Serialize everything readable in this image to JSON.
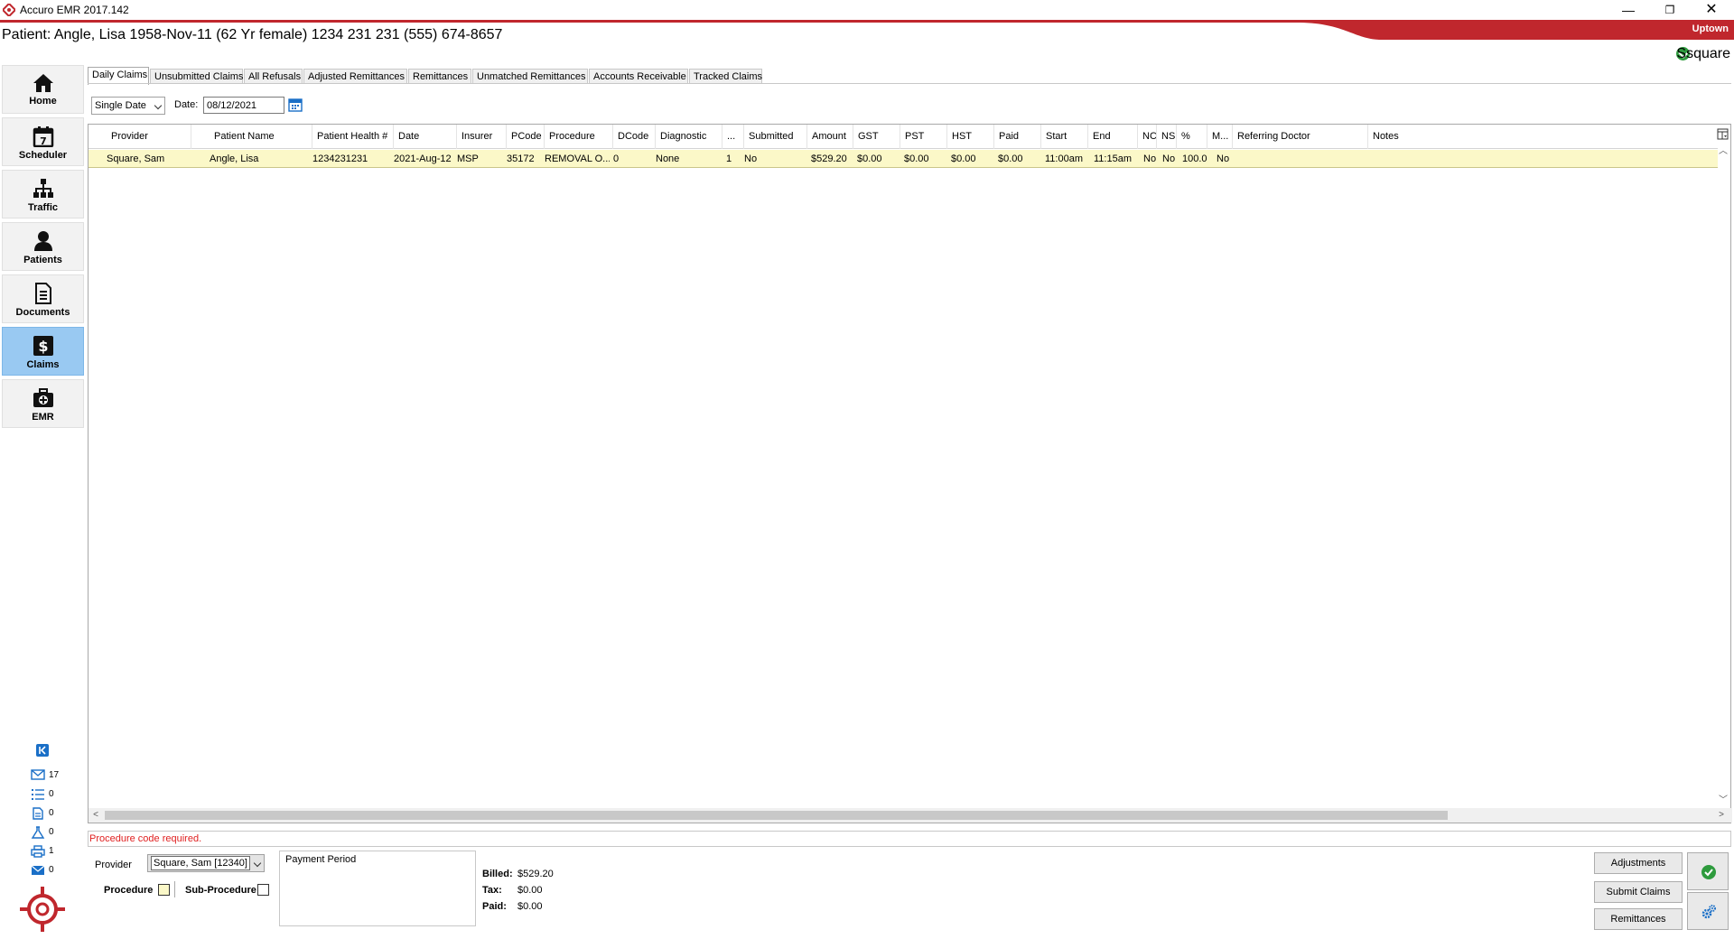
{
  "window": {
    "title": "Accuro EMR 2017.142",
    "minimize_glyph": "—",
    "restore_glyph": "❐",
    "close_glyph": "✕",
    "location": "Uptown",
    "accent_color": "#c0272d"
  },
  "header": {
    "patient": "Patient: Angle, Lisa 1958-Nov-11 (62 Yr female) 1234 231 231 (555) 674-8657",
    "user": "Ssquare"
  },
  "sidebar": {
    "items": [
      {
        "label": "Home",
        "icon": "home-icon"
      },
      {
        "label": "Scheduler",
        "icon": "calendar-icon"
      },
      {
        "label": "Traffic",
        "icon": "org-chart-icon"
      },
      {
        "label": "Patients",
        "icon": "person-icon"
      },
      {
        "label": "Documents",
        "icon": "document-icon"
      },
      {
        "label": "Claims",
        "icon": "dollar-icon",
        "active": true
      },
      {
        "label": "EMR",
        "icon": "medical-bag-icon"
      }
    ],
    "counters": [
      {
        "icon": "mail-icon",
        "value": "17"
      },
      {
        "icon": "task-list-icon",
        "value": "0"
      },
      {
        "icon": "document-icon",
        "value": "0"
      },
      {
        "icon": "lab-flask-icon",
        "value": "0"
      },
      {
        "icon": "printer-icon",
        "value": "1"
      },
      {
        "icon": "message-icon",
        "value": "0"
      }
    ]
  },
  "tabs": [
    {
      "label": "Daily Claims",
      "active": true
    },
    {
      "label": "Unsubmitted Claims"
    },
    {
      "label": "All Refusals"
    },
    {
      "label": "Adjusted Remittances"
    },
    {
      "label": "Remittances"
    },
    {
      "label": "Unmatched Remittances"
    },
    {
      "label": "Accounts Receivable"
    },
    {
      "label": "Tracked Claims"
    }
  ],
  "filter": {
    "mode": "Single Date",
    "date_label": "Date:",
    "date_value": "08/12/2021"
  },
  "grid": {
    "columns": [
      "Provider",
      "Patient Name",
      "Patient Health #",
      "Date",
      "Insurer",
      "PCode",
      "Procedure",
      "DCode",
      "Diagnostic",
      "...",
      "Submitted",
      "Amount",
      "GST",
      "PST",
      "HST",
      "Paid",
      "Start",
      "End",
      "NC",
      "NS",
      "%",
      "M...",
      "Referring Doctor",
      "Notes"
    ],
    "rows": [
      [
        "Square, Sam",
        "Angle, Lisa",
        "1234231231",
        "2021-Aug-12",
        "MSP",
        "35172",
        "REMOVAL O...",
        "0",
        "None",
        "1",
        "No",
        "$529.20",
        "$0.00",
        "$0.00",
        "$0.00",
        "$0.00",
        "11:00am",
        "11:15am",
        "No",
        "No",
        "100.0",
        "No",
        "",
        ""
      ]
    ]
  },
  "status_message": "Procedure code required.",
  "bottom": {
    "provider_label": "Provider",
    "provider_value": "Square, Sam [12340]",
    "procedure_label": "Procedure",
    "subprocedure_label": "Sub-Procedure",
    "payment_period_label": "Payment Period",
    "billed_label": "Billed:",
    "billed_value": "$529.20",
    "tax_label": "Tax:",
    "tax_value": "$0.00",
    "paid_label": "Paid:",
    "paid_value": "$0.00",
    "adjustments_label": "Adjustments",
    "submit_label": "Submit Claims",
    "remittances_label": "Remittances"
  }
}
